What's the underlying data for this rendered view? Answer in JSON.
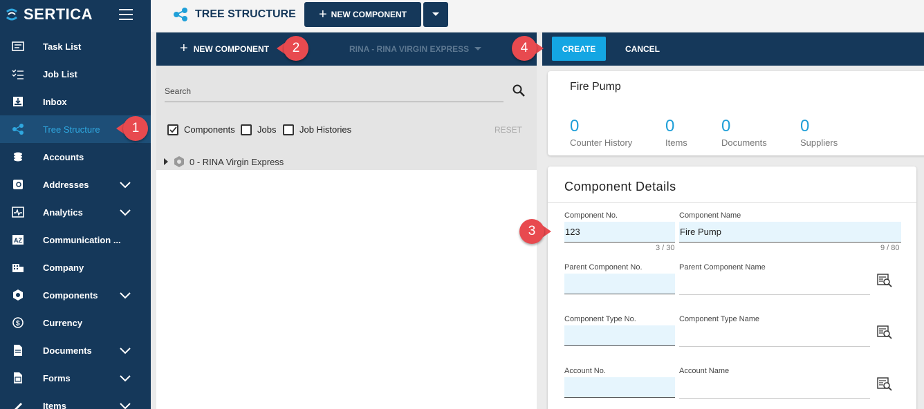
{
  "app": {
    "brand": "SERTICA"
  },
  "sidebar": {
    "items": [
      {
        "label": "Task List",
        "icon": "task-list-icon"
      },
      {
        "label": "Job List",
        "icon": "job-list-icon"
      },
      {
        "label": "Inbox",
        "icon": "inbox-icon"
      },
      {
        "label": "Tree Structure",
        "icon": "tree-structure-icon",
        "active": true
      },
      {
        "label": "Accounts",
        "icon": "accounts-icon"
      },
      {
        "label": "Addresses",
        "icon": "addresses-icon",
        "expandable": true
      },
      {
        "label": "Analytics",
        "icon": "analytics-icon",
        "expandable": true
      },
      {
        "label": "Communication ...",
        "icon": "communication-icon"
      },
      {
        "label": "Company",
        "icon": "company-icon"
      },
      {
        "label": "Components",
        "icon": "components-icon",
        "expandable": true
      },
      {
        "label": "Currency",
        "icon": "currency-icon"
      },
      {
        "label": "Documents",
        "icon": "documents-icon",
        "expandable": true
      },
      {
        "label": "Forms",
        "icon": "forms-icon",
        "expandable": true
      },
      {
        "label": "Items",
        "icon": "items-icon",
        "expandable": true
      }
    ]
  },
  "header": {
    "title": "TREE STRUCTURE",
    "new_component_label": "NEW COMPONENT"
  },
  "left_panel": {
    "new_component_label": "NEW COMPONENT",
    "vessel_select": "RINA - RINA VIRGIN EXPRESS",
    "search_placeholder": "Search",
    "filters": [
      {
        "label": "Components",
        "checked": true
      },
      {
        "label": "Jobs",
        "checked": false
      },
      {
        "label": "Job Histories",
        "checked": false
      }
    ],
    "reset_label": "RESET",
    "tree_root": "0 - RINA Virgin Express"
  },
  "right_panel": {
    "create_label": "CREATE",
    "cancel_label": "CANCEL",
    "summary": {
      "title": "Fire Pump",
      "stats": [
        {
          "value": "0",
          "label": "Counter History"
        },
        {
          "value": "0",
          "label": "Items"
        },
        {
          "value": "0",
          "label": "Documents"
        },
        {
          "value": "0",
          "label": "Suppliers"
        }
      ]
    },
    "details": {
      "title": "Component Details",
      "component_no_label": "Component No.",
      "component_no_value": "123",
      "component_no_counter": "3 / 30",
      "component_name_label": "Component Name",
      "component_name_value": "Fire Pump",
      "component_name_counter": "9 / 80",
      "parent_no_label": "Parent Component No.",
      "parent_name_label": "Parent Component Name",
      "type_no_label": "Component Type No.",
      "type_name_label": "Component Type Name",
      "account_no_label": "Account No.",
      "account_name_label": "Account Name"
    }
  },
  "callouts": [
    "1",
    "2",
    "3",
    "4"
  ],
  "colors": {
    "sidebar_bg": "#15385a",
    "accent": "#14a6e3",
    "callout": "#e84a4f"
  }
}
